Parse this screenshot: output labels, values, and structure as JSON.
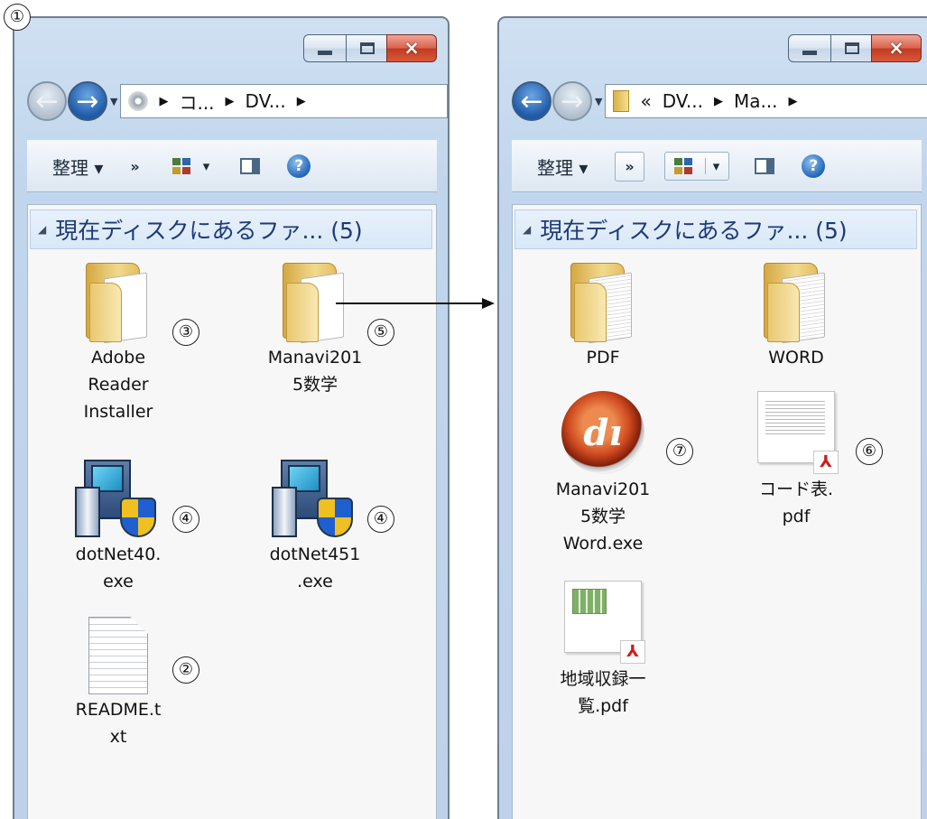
{
  "callouts": [
    "①",
    "②",
    "③",
    "④",
    "⑤",
    "⑥",
    "⑦"
  ],
  "windows": {
    "left": {
      "caption_buttons": {
        "minimize": "minimize",
        "maximize": "maximize",
        "close": "×"
      },
      "address": [
        "コ...",
        "DV..."
      ],
      "toolbar": {
        "organize": "整理 ▾",
        "more": "»",
        "view_drop": "▾",
        "help": "?"
      },
      "group": {
        "title": "現在ディスクにあるファ... (5)"
      },
      "items": [
        {
          "label": "Adobe\nReader\nInstaller",
          "type": "folder",
          "callout": "③"
        },
        {
          "label": "Manavi201\n5数学",
          "type": "folder",
          "callout": "⑤"
        },
        {
          "label": "dotNet40.\nexe",
          "type": "installer",
          "callout": "④"
        },
        {
          "label": "dotNet451\n.exe",
          "type": "installer",
          "callout": "④"
        },
        {
          "label": "README.t\nxt",
          "type": "txt",
          "callout": "②"
        }
      ]
    },
    "right": {
      "caption_buttons": {
        "minimize": "minimize",
        "maximize": "maximize",
        "close": "×"
      },
      "address": [
        "«",
        "DV...",
        "Ma..."
      ],
      "toolbar": {
        "organize": "整理 ▾",
        "more": "»",
        "view_drop": "▾",
        "help": "?"
      },
      "group": {
        "title": "現在ディスクにあるファ... (5)"
      },
      "items": [
        {
          "label": "PDF",
          "type": "folder"
        },
        {
          "label": "WORD",
          "type": "folder"
        },
        {
          "label": "Manavi201\n5数学\nWord.exe",
          "type": "app",
          "callout": "⑦"
        },
        {
          "label": "コード表.\npdf",
          "type": "pdf",
          "callout": "⑥"
        },
        {
          "label": "地域収録一\n覧.pdf",
          "type": "pdf"
        }
      ]
    }
  },
  "icons": {
    "back": "back-arrow-icon",
    "forward": "forward-arrow-icon",
    "disc": "cd-icon",
    "folder": "folder-icon",
    "installer": "installer-icon",
    "txt": "text-file-icon",
    "pdf": "pdf-file-icon",
    "app": "application-icon",
    "help": "help-icon",
    "pane": "preview-pane-icon"
  },
  "colors": {
    "accent": "#1d3a78",
    "close": "#c03b22",
    "frame": "#c1d6ed"
  }
}
